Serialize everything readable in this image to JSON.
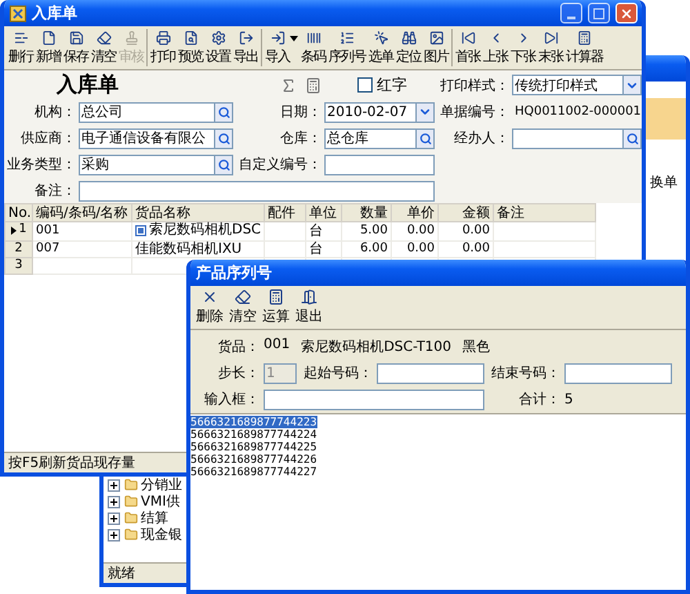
{
  "background_window": {
    "right_text": "换单",
    "tree": [
      {
        "label": "分销业",
        "expanded": false
      },
      {
        "label": "VMI供",
        "expanded": false
      },
      {
        "label": "结算",
        "expanded": false
      },
      {
        "label": "现金银",
        "expanded": false
      }
    ],
    "status": "就绪"
  },
  "main_window": {
    "title": "入库单",
    "toolbar": [
      [
        {
          "label": "删行",
          "disabled": false,
          "dropdown": false
        },
        {
          "label": "新增",
          "disabled": false,
          "dropdown": false
        },
        {
          "label": "保存",
          "disabled": false,
          "dropdown": false
        },
        {
          "label": "清空",
          "disabled": false,
          "dropdown": false
        },
        {
          "label": "审核",
          "disabled": true,
          "dropdown": false
        }
      ],
      [
        {
          "label": "打印",
          "disabled": false,
          "dropdown": false
        },
        {
          "label": "预览",
          "disabled": false,
          "dropdown": false
        },
        {
          "label": "设置",
          "disabled": false,
          "dropdown": false
        },
        {
          "label": "导出",
          "disabled": false,
          "dropdown": false
        }
      ],
      [
        {
          "label": "导入",
          "disabled": false,
          "dropdown": true
        },
        {
          "label": "条码",
          "disabled": false,
          "dropdown": false
        },
        {
          "label": "序列号",
          "disabled": false,
          "dropdown": false
        },
        {
          "label": "选单",
          "disabled": false,
          "dropdown": false
        },
        {
          "label": "定位",
          "disabled": false,
          "dropdown": false
        },
        {
          "label": "图片",
          "disabled": false,
          "dropdown": false
        }
      ],
      [
        {
          "label": "首张",
          "disabled": false,
          "dropdown": false
        },
        {
          "label": "上张",
          "disabled": false,
          "dropdown": false
        },
        {
          "label": "下张",
          "disabled": false,
          "dropdown": false
        },
        {
          "label": "末张",
          "disabled": false,
          "dropdown": false
        },
        {
          "label": "计算器",
          "disabled": false,
          "dropdown": false
        }
      ]
    ],
    "form": {
      "heading": "入库单",
      "red_text": {
        "label": "红字",
        "checked": false
      },
      "print_style": {
        "label": "打印样式：",
        "value": "传统打印样式"
      },
      "rows": [
        [
          {
            "label": "机构：",
            "kind": "search",
            "value": "总公司"
          },
          {
            "label": "日期：",
            "kind": "dropdown",
            "value": "2010-02-07"
          },
          {
            "label": "单据编号：",
            "kind": "static",
            "value": "HQ0011002-000001"
          }
        ],
        [
          {
            "label": "供应商：",
            "kind": "search",
            "value": "电子通信设备有限公"
          },
          {
            "label": "仓库：",
            "kind": "search",
            "value": "总仓库"
          },
          {
            "label": "经办人：",
            "kind": "search"
          }
        ],
        [
          {
            "label": "业务类型：",
            "kind": "search",
            "value": "采购"
          },
          {
            "label": "自定义编号：",
            "kind": "text"
          }
        ],
        [
          {
            "label": "备注：",
            "kind": "wide"
          }
        ]
      ]
    },
    "grid": {
      "columns": [
        "No.",
        "编码/条码/名称",
        "货品名称",
        "配件",
        "单位",
        "数量",
        "单价",
        "金额",
        "备注"
      ],
      "rows": [
        {
          "selected": true,
          "flagged": true,
          "cells": [
            "1",
            "001",
            "索尼数码相机DSC",
            null,
            "台",
            "5.00",
            "0.00",
            "0.00",
            null
          ]
        },
        {
          "selected": false,
          "flagged": false,
          "cells": [
            "2",
            "007",
            "佳能数码相机IXU",
            null,
            "台",
            "6.00",
            "0.00",
            "0.00",
            null
          ]
        },
        {
          "selected": false,
          "flagged": false,
          "cells": [
            "3",
            null,
            null,
            null,
            null,
            null,
            null,
            null,
            null
          ]
        }
      ]
    },
    "status": "按F5刷新货品现存量"
  },
  "dialog": {
    "title": "产品序列号",
    "toolbar": [
      "删除",
      "清空",
      "运算",
      "退出"
    ],
    "product": {
      "label": "货品：",
      "code": "001",
      "name": "索尼数码相机DSC-T100",
      "variant": "黑色"
    },
    "step": {
      "label": "步长：",
      "value": "1",
      "disabled": true
    },
    "start": {
      "label": "起始号码："
    },
    "end": {
      "label": "结束号码："
    },
    "input": {
      "label": "输入框："
    },
    "total": {
      "label": "合计：",
      "value": "5"
    },
    "serials": [
      {
        "text": "5666321689877744223",
        "selected": true
      },
      {
        "text": "5666321689877744224",
        "selected": false
      },
      {
        "text": "5666321689877744225",
        "selected": false
      },
      {
        "text": "5666321689877744226",
        "selected": false
      },
      {
        "text": "5666321689877744227",
        "selected": false
      }
    ]
  }
}
